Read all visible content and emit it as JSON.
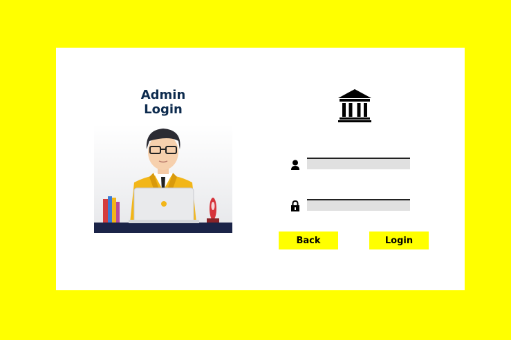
{
  "page": {
    "title": "Admin Login"
  },
  "form": {
    "username": {
      "icon": "user-icon",
      "value": "",
      "placeholder": ""
    },
    "password": {
      "icon": "lock-icon",
      "value": "",
      "placeholder": ""
    }
  },
  "buttons": {
    "back_label": "Back",
    "login_label": "Login"
  },
  "icons": {
    "header": "bank-building-icon"
  },
  "colors": {
    "background": "#ffff00",
    "card": "#ffffff",
    "title": "#0d2b4e",
    "button": "#ffff00",
    "field": "#e0e0e0"
  }
}
